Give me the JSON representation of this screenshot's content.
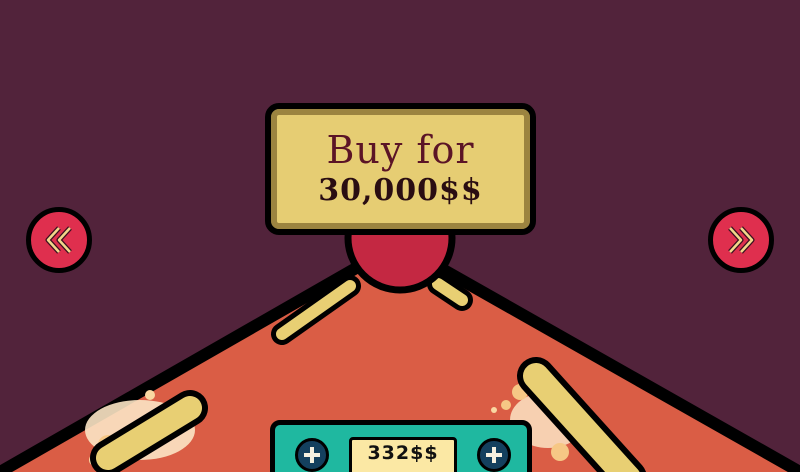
{
  "shop": {
    "buy_label": "Buy for",
    "price": "30,000$$"
  },
  "navigation": {
    "prev_icon": "double-chevron-left-icon",
    "next_icon": "double-chevron-right-icon"
  },
  "wallet": {
    "balance": "332$$",
    "add_icon": "plus-icon"
  },
  "colors": {
    "background": "#52233b",
    "table_surface": "#da5d45",
    "sign_fill": "#e6cd73",
    "sign_text": "#5b1426",
    "nav_button": "#df2f4e",
    "panel_teal": "#1fb8a0",
    "flipper_yellow": "#e8cf73",
    "bumper_red": "#c42842"
  }
}
